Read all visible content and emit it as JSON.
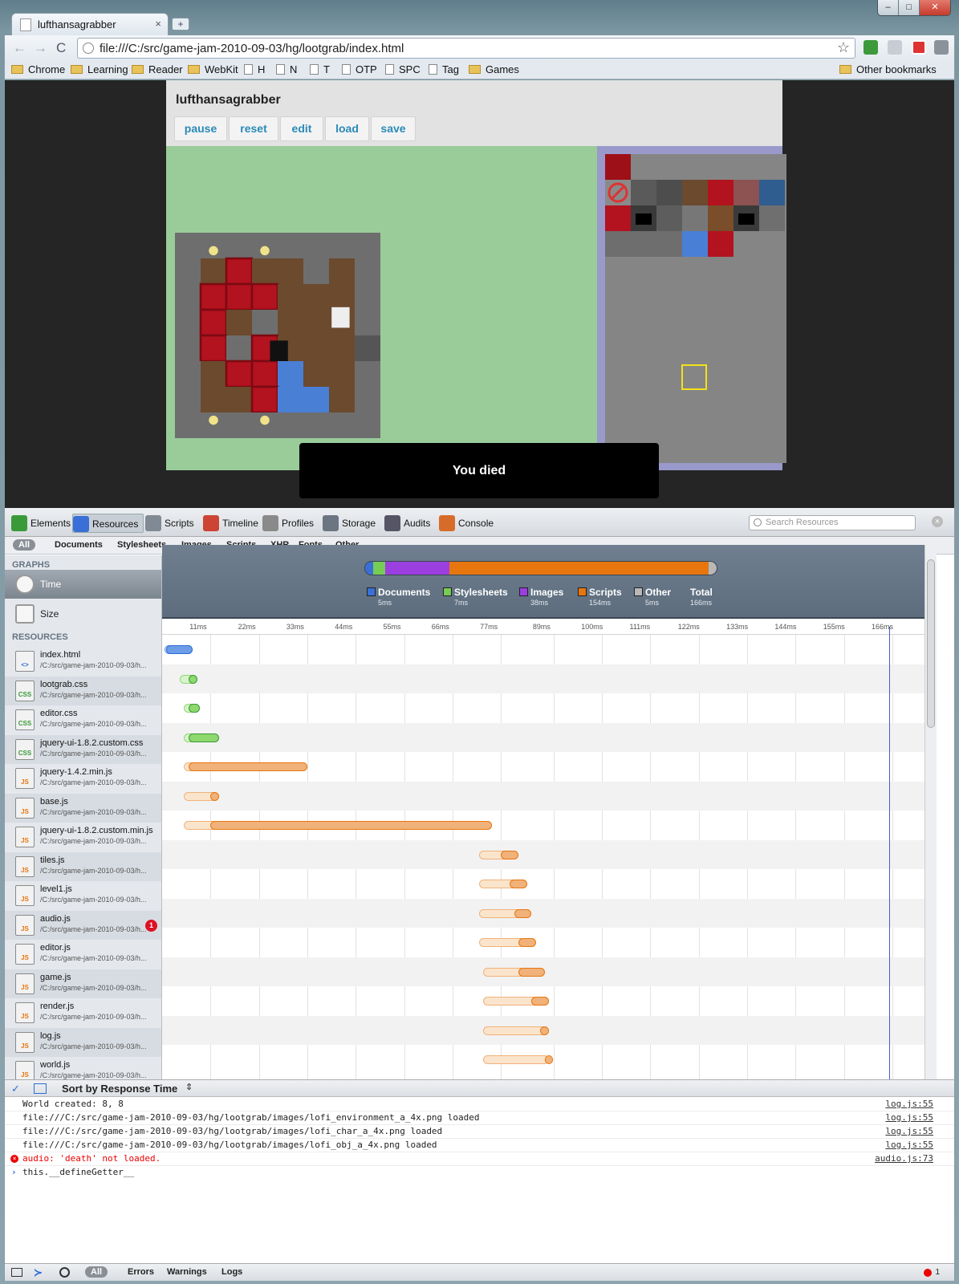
{
  "window": {
    "tab_title": "lufthansagrabber",
    "tab_close": "×",
    "new_tab": "+",
    "win_min": "–",
    "win_max": "□",
    "win_close": "✕"
  },
  "toolbar": {
    "back": "←",
    "forward": "→",
    "reload": "C",
    "url": "file:///C:/src/game-jam-2010-09-03/hg/lootgrab/index.html",
    "star": "☆"
  },
  "bookmarks": [
    {
      "label": "Chrome",
      "icon": "folder-icon"
    },
    {
      "label": "Learning",
      "icon": "folder-icon"
    },
    {
      "label": "Reader",
      "icon": "folder-icon"
    },
    {
      "label": "WebKit",
      "icon": "folder-icon"
    },
    {
      "label": "H",
      "icon": "page-icon"
    },
    {
      "label": "N",
      "icon": "page-icon"
    },
    {
      "label": "T",
      "icon": "page-icon"
    },
    {
      "label": "OTP",
      "icon": "page-icon"
    },
    {
      "label": "SPC",
      "icon": "page-icon"
    },
    {
      "label": "Tag",
      "icon": "page-icon"
    },
    {
      "label": "Games",
      "icon": "folder-icon"
    }
  ],
  "other_bookmarks": "Other bookmarks",
  "app": {
    "title": "lufthansagrabber",
    "buttons": [
      "pause",
      "reset",
      "edit",
      "load",
      "save"
    ],
    "message": "You died",
    "colors": {
      "stage": "#99cc99",
      "palette": "#9999cc",
      "floor": "#6b4a2e",
      "wall": "#6e6e6e",
      "block": "#b3121f",
      "water": "#4a7fd6"
    }
  },
  "devtools": {
    "tabs": [
      "Elements",
      "Resources",
      "Scripts",
      "Timeline",
      "Profiles",
      "Storage",
      "Audits",
      "Console"
    ],
    "selected_tab": "Resources",
    "search_placeholder": "Search Resources",
    "filters": [
      "All",
      "Documents",
      "Stylesheets",
      "Images",
      "Scripts",
      "XHR",
      "Fonts",
      "Other"
    ],
    "graphs_header": "GRAPHS",
    "graphs": [
      "Time",
      "Size"
    ],
    "resources_header": "RESOURCES",
    "sort_label": "Sort by Response Time",
    "summary": [
      {
        "label": "Documents",
        "value": "5ms",
        "color": "#3a6fd8"
      },
      {
        "label": "Stylesheets",
        "value": "7ms",
        "color": "#77cc55"
      },
      {
        "label": "Images",
        "value": "38ms",
        "color": "#9b3fe0"
      },
      {
        "label": "Scripts",
        "value": "154ms",
        "color": "#e8760f"
      },
      {
        "label": "Other",
        "value": "5ms",
        "color": "#b8b8b8"
      },
      {
        "label": "Total",
        "value": "166ms",
        "color": ""
      }
    ],
    "ticks": [
      "11ms",
      "22ms",
      "33ms",
      "44ms",
      "55ms",
      "66ms",
      "77ms",
      "89ms",
      "100ms",
      "111ms",
      "122ms",
      "133ms",
      "144ms",
      "155ms",
      "166ms"
    ],
    "resources": [
      {
        "name": "index.html",
        "path": "/C:/src/game-jam-2010-09-03/h...",
        "type": "html",
        "lat": [
          0.5,
          7
        ],
        "dl": [
          1,
          7
        ],
        "errors": ""
      },
      {
        "name": "lootgrab.css",
        "path": "/C:/src/game-jam-2010-09-03/h...",
        "type": "css",
        "lat": [
          4,
          8
        ],
        "dl": [
          6,
          8
        ],
        "errors": ""
      },
      {
        "name": "editor.css",
        "path": "/C:/src/game-jam-2010-09-03/h...",
        "type": "css",
        "lat": [
          5,
          8.5
        ],
        "dl": [
          6,
          8.5
        ],
        "errors": ""
      },
      {
        "name": "jquery-ui-1.8.2.custom.css",
        "path": "/C:/src/game-jam-2010-09-03/h...",
        "type": "css",
        "lat": [
          5,
          13
        ],
        "dl": [
          6,
          13
        ],
        "errors": ""
      },
      {
        "name": "jquery-1.4.2.min.js",
        "path": "/C:/src/game-jam-2010-09-03/h...",
        "type": "js",
        "lat": [
          5,
          33
        ],
        "dl": [
          6,
          33
        ],
        "errors": ""
      },
      {
        "name": "base.js",
        "path": "/C:/src/game-jam-2010-09-03/h...",
        "type": "js",
        "lat": [
          5,
          13
        ],
        "dl": [
          11,
          13
        ],
        "errors": ""
      },
      {
        "name": "jquery-ui-1.8.2.custom.min.js",
        "path": "/C:/src/game-jam-2010-09-03/h...",
        "type": "js",
        "lat": [
          5,
          75
        ],
        "dl": [
          11,
          75
        ],
        "errors": ""
      },
      {
        "name": "tiles.js",
        "path": "/C:/src/game-jam-2010-09-03/h...",
        "type": "js",
        "lat": [
          72,
          81
        ],
        "dl": [
          77,
          81
        ],
        "errors": ""
      },
      {
        "name": "level1.js",
        "path": "/C:/src/game-jam-2010-09-03/h...",
        "type": "js",
        "lat": [
          72,
          83
        ],
        "dl": [
          79,
          83
        ],
        "errors": ""
      },
      {
        "name": "audio.js",
        "path": "/C:/src/game-jam-2010-09-03/h...",
        "type": "js",
        "lat": [
          72,
          84
        ],
        "dl": [
          80,
          84
        ],
        "errors": "1"
      },
      {
        "name": "editor.js",
        "path": "/C:/src/game-jam-2010-09-03/h...",
        "type": "js",
        "lat": [
          72,
          85
        ],
        "dl": [
          81,
          85
        ],
        "errors": ""
      },
      {
        "name": "game.js",
        "path": "/C:/src/game-jam-2010-09-03/h...",
        "type": "js",
        "lat": [
          73,
          87
        ],
        "dl": [
          81,
          87
        ],
        "errors": ""
      },
      {
        "name": "render.js",
        "path": "/C:/src/game-jam-2010-09-03/h...",
        "type": "js",
        "lat": [
          73,
          88
        ],
        "dl": [
          84,
          88
        ],
        "errors": ""
      },
      {
        "name": "log.js",
        "path": "/C:/src/game-jam-2010-09-03/h...",
        "type": "js",
        "lat": [
          73,
          88
        ],
        "dl": [
          86,
          88
        ],
        "errors": ""
      },
      {
        "name": "world.js",
        "path": "/C:/src/game-jam-2010-09-03/h...",
        "type": "js",
        "lat": [
          73,
          88
        ],
        "dl": [
          87,
          88
        ],
        "errors": ""
      }
    ],
    "console": [
      {
        "text": "World created: 8, 8",
        "src": "log.js:55",
        "kind": "log"
      },
      {
        "text": "file:///C:/src/game-jam-2010-09-03/hg/lootgrab/images/lofi_environment_a_4x.png loaded",
        "src": "log.js:55",
        "kind": "log"
      },
      {
        "text": "file:///C:/src/game-jam-2010-09-03/hg/lootgrab/images/lofi_char_a_4x.png loaded",
        "src": "log.js:55",
        "kind": "log"
      },
      {
        "text": "file:///C:/src/game-jam-2010-09-03/hg/lootgrab/images/lofi_obj_a_4x.png loaded",
        "src": "log.js:55",
        "kind": "log"
      },
      {
        "text": "audio: 'death' not loaded.",
        "src": "audio.js:73",
        "kind": "error"
      },
      {
        "text": "this.__defineGetter__",
        "src": "",
        "kind": "prompt"
      }
    ],
    "console_filters": [
      "All",
      "Errors",
      "Warnings",
      "Logs"
    ],
    "error_count": "1"
  }
}
